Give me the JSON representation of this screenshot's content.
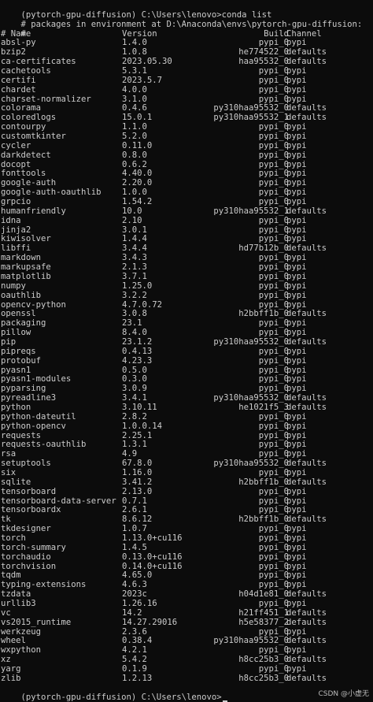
{
  "prompt_line": "(pytorch-gpu-diffusion) C:\\Users\\lenovo>conda list",
  "env_header": "# packages in environment at D:\\Anaconda\\envs\\pytorch-gpu-diffusion:",
  "blank_comment": "#",
  "columns": {
    "hash": "#",
    "name": "Name",
    "version": "Version",
    "build": "Build",
    "channel": "Channel"
  },
  "packages": [
    [
      "absl-py",
      "1.4.0",
      "pypi_0",
      "pypi"
    ],
    [
      "bzip2",
      "1.0.8",
      "he774522_0",
      "defaults"
    ],
    [
      "ca-certificates",
      "2023.05.30",
      "haa95532_0",
      "defaults"
    ],
    [
      "cachetools",
      "5.3.1",
      "pypi_0",
      "pypi"
    ],
    [
      "certifi",
      "2023.5.7",
      "pypi_0",
      "pypi"
    ],
    [
      "chardet",
      "4.0.0",
      "pypi_0",
      "pypi"
    ],
    [
      "charset-normalizer",
      "3.1.0",
      "pypi_0",
      "pypi"
    ],
    [
      "colorama",
      "0.4.6",
      "py310haa95532_0",
      "defaults"
    ],
    [
      "coloredlogs",
      "15.0.1",
      "py310haa95532_1",
      "defaults"
    ],
    [
      "contourpy",
      "1.1.0",
      "pypi_0",
      "pypi"
    ],
    [
      "customtkinter",
      "5.2.0",
      "pypi_0",
      "pypi"
    ],
    [
      "cycler",
      "0.11.0",
      "pypi_0",
      "pypi"
    ],
    [
      "darkdetect",
      "0.8.0",
      "pypi_0",
      "pypi"
    ],
    [
      "docopt",
      "0.6.2",
      "pypi_0",
      "pypi"
    ],
    [
      "fonttools",
      "4.40.0",
      "pypi_0",
      "pypi"
    ],
    [
      "google-auth",
      "2.20.0",
      "pypi_0",
      "pypi"
    ],
    [
      "google-auth-oauthlib",
      "1.0.0",
      "pypi_0",
      "pypi"
    ],
    [
      "grpcio",
      "1.54.2",
      "pypi_0",
      "pypi"
    ],
    [
      "humanfriendly",
      "10.0",
      "py310haa95532_1",
      "defaults"
    ],
    [
      "idna",
      "2.10",
      "pypi_0",
      "pypi"
    ],
    [
      "jinja2",
      "3.0.1",
      "pypi_0",
      "pypi"
    ],
    [
      "kiwisolver",
      "1.4.4",
      "pypi_0",
      "pypi"
    ],
    [
      "libffi",
      "3.4.4",
      "hd77b12b_0",
      "defaults"
    ],
    [
      "markdown",
      "3.4.3",
      "pypi_0",
      "pypi"
    ],
    [
      "markupsafe",
      "2.1.3",
      "pypi_0",
      "pypi"
    ],
    [
      "matplotlib",
      "3.7.1",
      "pypi_0",
      "pypi"
    ],
    [
      "numpy",
      "1.25.0",
      "pypi_0",
      "pypi"
    ],
    [
      "oauthlib",
      "3.2.2",
      "pypi_0",
      "pypi"
    ],
    [
      "opencv-python",
      "4.7.0.72",
      "pypi_0",
      "pypi"
    ],
    [
      "openssl",
      "3.0.8",
      "h2bbff1b_0",
      "defaults"
    ],
    [
      "packaging",
      "23.1",
      "pypi_0",
      "pypi"
    ],
    [
      "pillow",
      "8.4.0",
      "pypi_0",
      "pypi"
    ],
    [
      "pip",
      "23.1.2",
      "py310haa95532_0",
      "defaults"
    ],
    [
      "pipreqs",
      "0.4.13",
      "pypi_0",
      "pypi"
    ],
    [
      "protobuf",
      "4.23.3",
      "pypi_0",
      "pypi"
    ],
    [
      "pyasn1",
      "0.5.0",
      "pypi_0",
      "pypi"
    ],
    [
      "pyasn1-modules",
      "0.3.0",
      "pypi_0",
      "pypi"
    ],
    [
      "pyparsing",
      "3.0.9",
      "pypi_0",
      "pypi"
    ],
    [
      "pyreadline3",
      "3.4.1",
      "py310haa95532_0",
      "defaults"
    ],
    [
      "python",
      "3.10.11",
      "he1021f5_3",
      "defaults"
    ],
    [
      "python-dateutil",
      "2.8.2",
      "pypi_0",
      "pypi"
    ],
    [
      "python-opencv",
      "1.0.0.14",
      "pypi_0",
      "pypi"
    ],
    [
      "requests",
      "2.25.1",
      "pypi_0",
      "pypi"
    ],
    [
      "requests-oauthlib",
      "1.3.1",
      "pypi_0",
      "pypi"
    ],
    [
      "rsa",
      "4.9",
      "pypi_0",
      "pypi"
    ],
    [
      "setuptools",
      "67.8.0",
      "py310haa95532_0",
      "defaults"
    ],
    [
      "six",
      "1.16.0",
      "pypi_0",
      "pypi"
    ],
    [
      "sqlite",
      "3.41.2",
      "h2bbff1b_0",
      "defaults"
    ],
    [
      "tensorboard",
      "2.13.0",
      "pypi_0",
      "pypi"
    ],
    [
      "tensorboard-data-server",
      "0.7.1",
      "pypi_0",
      "pypi"
    ],
    [
      "tensorboardx",
      "2.6.1",
      "pypi_0",
      "pypi"
    ],
    [
      "tk",
      "8.6.12",
      "h2bbff1b_0",
      "defaults"
    ],
    [
      "tkdesigner",
      "1.0.7",
      "pypi_0",
      "pypi"
    ],
    [
      "torch",
      "1.13.0+cu116",
      "pypi_0",
      "pypi"
    ],
    [
      "torch-summary",
      "1.4.5",
      "pypi_0",
      "pypi"
    ],
    [
      "torchaudio",
      "0.13.0+cu116",
      "pypi_0",
      "pypi"
    ],
    [
      "torchvision",
      "0.14.0+cu116",
      "pypi_0",
      "pypi"
    ],
    [
      "tqdm",
      "4.65.0",
      "pypi_0",
      "pypi"
    ],
    [
      "typing-extensions",
      "4.6.3",
      "pypi_0",
      "pypi"
    ],
    [
      "tzdata",
      "2023c",
      "h04d1e81_0",
      "defaults"
    ],
    [
      "urllib3",
      "1.26.16",
      "pypi_0",
      "pypi"
    ],
    [
      "vc",
      "14.2",
      "h21ff451_1",
      "defaults"
    ],
    [
      "vs2015_runtime",
      "14.27.29016",
      "h5e58377_2",
      "defaults"
    ],
    [
      "werkzeug",
      "2.3.6",
      "pypi_0",
      "pypi"
    ],
    [
      "wheel",
      "0.38.4",
      "py310haa95532_0",
      "defaults"
    ],
    [
      "wxpython",
      "4.2.1",
      "pypi_0",
      "pypi"
    ],
    [
      "xz",
      "5.4.2",
      "h8cc25b3_0",
      "defaults"
    ],
    [
      "yarg",
      "0.1.9",
      "pypi_0",
      "pypi"
    ],
    [
      "zlib",
      "1.2.13",
      "h8cc25b3_0",
      "defaults"
    ]
  ],
  "final_prompt": "(pytorch-gpu-diffusion) C:\\Users\\lenovo>",
  "watermark": "CSDN @小虚无",
  "colors": {
    "background": "#0c0c0c",
    "foreground": "#cccccc"
  }
}
